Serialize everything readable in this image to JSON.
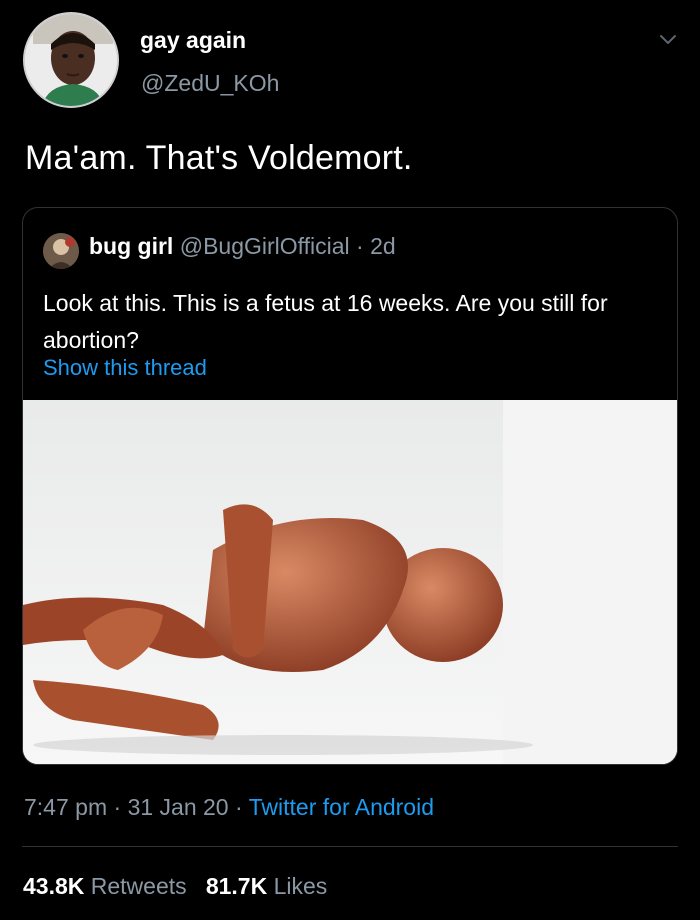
{
  "tweet": {
    "author_name": "gay again",
    "author_handle": "@ZedU_KOh",
    "text": "Ma'am. That's Voldemort.",
    "time": "7:47 pm",
    "date": "31 Jan 20",
    "source": "Twitter for Android",
    "sep": "·"
  },
  "quoted": {
    "author_name": "bug girl",
    "author_handle": "@BugGirlOfficial",
    "age": "2d",
    "text": "Look at this. This is a fetus at 16 weeks. Are you still for abortion?",
    "show_thread": "Show this thread"
  },
  "stats": {
    "retweets_count": "43.8K",
    "retweets_label": "Retweets",
    "likes_count": "81.7K",
    "likes_label": "Likes"
  },
  "icons": {
    "menu": "chevron-down-icon",
    "avatar": "user-avatar",
    "quoted_avatar": "quoted-user-avatar"
  },
  "colors": {
    "background": "#000000",
    "link": "#1d9bf0",
    "secondary_text": "#8b98a5",
    "border": "#2f3336"
  }
}
